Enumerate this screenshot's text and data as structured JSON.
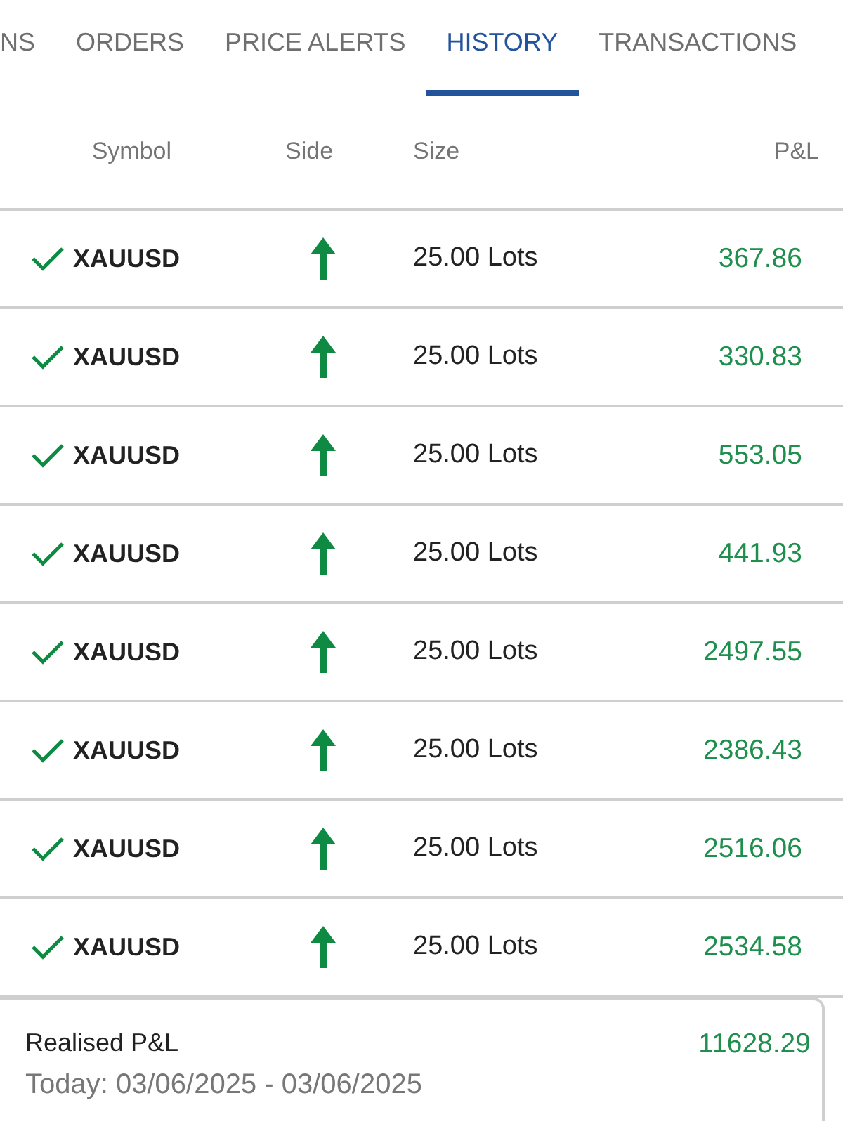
{
  "tabs": [
    {
      "label": "NS",
      "selected": false
    },
    {
      "label": "ORDERS",
      "selected": false
    },
    {
      "label": "PRICE ALERTS",
      "selected": false
    },
    {
      "label": "HISTORY",
      "selected": true
    },
    {
      "label": "TRANSACTIONS",
      "selected": false
    }
  ],
  "table": {
    "columns": [
      "Symbol",
      "Side",
      "Size",
      "P&L"
    ],
    "rows": [
      {
        "symbol": "XAUUSD",
        "buy": true,
        "size": "25.00 Lots",
        "pnl": "367.86"
      },
      {
        "symbol": "XAUUSD",
        "buy": true,
        "size": "25.00 Lots",
        "pnl": "330.83"
      },
      {
        "symbol": "XAUUSD",
        "buy": true,
        "size": "25.00 Lots",
        "pnl": "553.05"
      },
      {
        "symbol": "XAUUSD",
        "buy": true,
        "size": "25.00 Lots",
        "pnl": "441.93"
      },
      {
        "symbol": "XAUUSD",
        "buy": true,
        "size": "25.00 Lots",
        "pnl": "2497.55"
      },
      {
        "symbol": "XAUUSD",
        "buy": true,
        "size": "25.00 Lots",
        "pnl": "2386.43"
      },
      {
        "symbol": "XAUUSD",
        "buy": true,
        "size": "25.00 Lots",
        "pnl": "2516.06"
      },
      {
        "symbol": "XAUUSD",
        "buy": true,
        "size": "25.00 Lots",
        "pnl": "2534.58"
      }
    ]
  },
  "summary": {
    "label": "Realised P&L",
    "period": "Today: 03/06/2025 - 03/06/2025",
    "value": "11628.29"
  }
}
